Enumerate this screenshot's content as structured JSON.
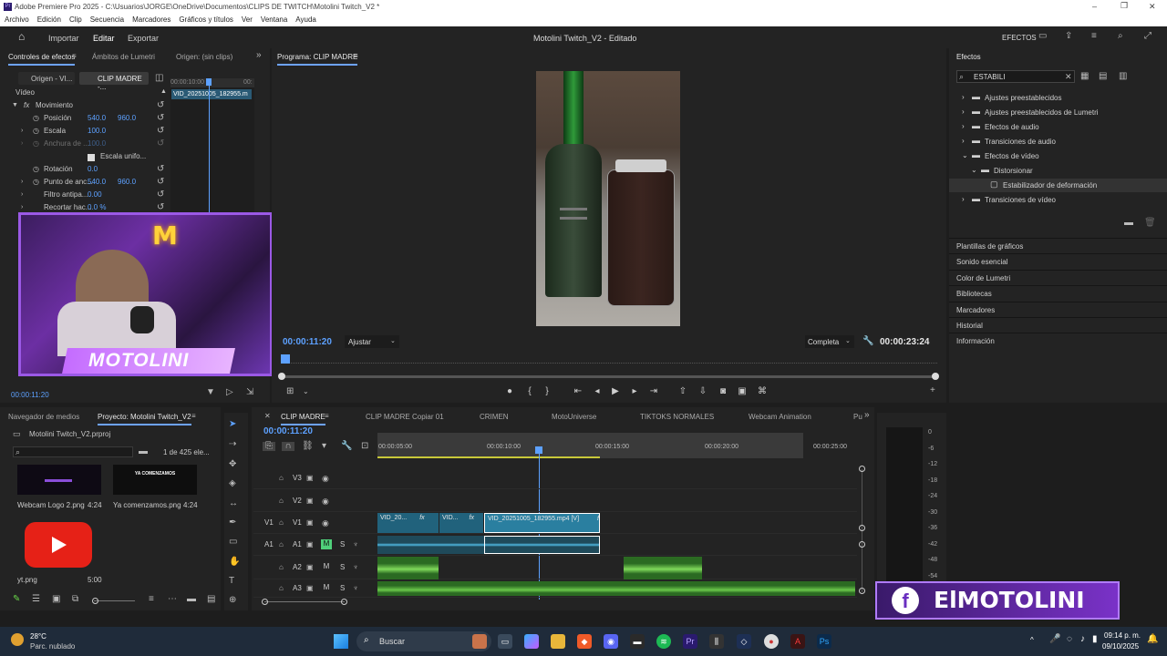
{
  "window": {
    "title": "Adobe Premiere Pro 2025 - C:\\Usuarios\\JORGE\\OneDrive\\Documentos\\CLIPS DE TWITCH\\Motolini Twitch_V2 *",
    "minimize": "–",
    "maximize": "❐",
    "close": "✕"
  },
  "menu": [
    "Archivo",
    "Edición",
    "Clip",
    "Secuencia",
    "Marcadores",
    "Gráficos y títulos",
    "Ver",
    "Ventana",
    "Ayuda"
  ],
  "appbar": {
    "tabs": [
      "Importar",
      "Editar",
      "Exportar"
    ],
    "project_title": "Motolini Twitch_V2 - Editado",
    "effects_label": "EFECTOS"
  },
  "effect_controls": {
    "tabs": [
      "Controles de efectos",
      "Ámbitos de Lumetri",
      "Origen: (sin clips)"
    ],
    "source_btn": "Origen - VI...",
    "seq_btn": "CLIP MADRE -...",
    "clip_name": "VID_20251005_182955.m",
    "ruler_time": "00:00:10:00",
    "ruler_end": "00:",
    "video_label": "Vídeo",
    "motion_label": "Movimiento",
    "props": [
      {
        "name": "Posición",
        "v1": "540.0",
        "v2": "960.0"
      },
      {
        "name": "Escala",
        "v1": "100.0",
        "v2": ""
      },
      {
        "name": "Anchura de ...",
        "v1": "100.0",
        "v2": ""
      },
      {
        "name": "Escala unifo...",
        "v1": "",
        "v2": ""
      },
      {
        "name": "Rotación",
        "v1": "0.0",
        "v2": ""
      },
      {
        "name": "Punto de anc...",
        "v1": "540.0",
        "v2": "960.0"
      },
      {
        "name": "Filtro antipa...",
        "v1": "0.00",
        "v2": ""
      },
      {
        "name": "Recortar hac...",
        "v1": "0.0 %",
        "v2": ""
      }
    ],
    "timecode": "00:00:11:20"
  },
  "webcam": {
    "logo_letter": "M",
    "name": "MOTOLINI"
  },
  "program": {
    "title": "Programa: CLIP MADRE",
    "timecode": "00:00:11:20",
    "fit": "Ajustar",
    "quality": "Completa",
    "duration": "00:00:23:24"
  },
  "effects_panel": {
    "title": "Efectos",
    "search_value": "ESTABILI",
    "tree": [
      {
        "label": "Ajustes preestablecidos",
        "level": 0,
        "open": false
      },
      {
        "label": "Ajustes preestablecidos de Lumetri",
        "level": 0,
        "open": false
      },
      {
        "label": "Efectos de audio",
        "level": 0,
        "open": false
      },
      {
        "label": "Transiciones de audio",
        "level": 0,
        "open": false
      },
      {
        "label": "Efectos de vídeo",
        "level": 0,
        "open": true
      },
      {
        "label": "Distorsionar",
        "level": 1,
        "open": true
      },
      {
        "label": "Estabilizador de deformación",
        "level": 2,
        "open": false
      },
      {
        "label": "Transiciones de vídeo",
        "level": 0,
        "open": false
      }
    ],
    "sections": [
      "Plantillas de gráficos",
      "Sonido esencial",
      "Color de Lumetri",
      "Bibliotecas",
      "Marcadores",
      "Historial",
      "Información"
    ]
  },
  "project_panel": {
    "tabs": [
      "Navegador de medios",
      "Proyecto: Motolini Twitch_V2"
    ],
    "file": "Motolini Twitch_V2.prproj",
    "count": "1 de 425 ele...",
    "items": [
      {
        "name": "Webcam Logo 2.png",
        "dur": "4:24"
      },
      {
        "name": "Ya comenzamos.png",
        "dur": "4:24",
        "thumb_text": "YA COMENZAMOS"
      },
      {
        "name": "yt.png",
        "dur": "5:00"
      }
    ]
  },
  "timeline": {
    "tabs": [
      "CLIP MADRE",
      "CLIP MADRE Copiar 01",
      "CRIMEN",
      "MotoUniverse",
      "TIKTOKS NORMALES",
      "Webcam Animation",
      "Pu"
    ],
    "timecode": "00:00:11:20",
    "ruler": [
      "00:00:05:00",
      "00:00:10:00",
      "00:00:15:00",
      "00:00:20:00",
      "00:00:25:00"
    ],
    "tracks": [
      {
        "src": "",
        "name": "V3"
      },
      {
        "src": "",
        "name": "V2"
      },
      {
        "src": "V1",
        "name": "V1"
      },
      {
        "src": "A1",
        "name": "A1",
        "m": "M",
        "s": "S"
      },
      {
        "src": "",
        "name": "A2",
        "m": "M",
        "s": "S"
      },
      {
        "src": "",
        "name": "A3",
        "m": "M",
        "s": "S"
      }
    ],
    "clips": [
      "VID_20...",
      "VID...",
      "VID_20251005_182955.mp4 [V]"
    ],
    "fx": "fx",
    "meter_scale": [
      "0",
      "-6",
      "-12",
      "-18",
      "-24",
      "-30",
      "-36",
      "-42",
      "-48",
      "-54"
    ]
  },
  "overlay": {
    "social": "ElMOTOLINI"
  },
  "taskbar": {
    "weather_temp": "28°C",
    "weather_desc": "Parc. nublado",
    "search": "Buscar",
    "time": "09:14 p. m.",
    "date": "09/10/2025"
  },
  "colors": {
    "accent": "#5da1ff",
    "video_clip": "#2a7fa0",
    "audio_clip": "#3a8f2e",
    "panel": "#232323"
  }
}
